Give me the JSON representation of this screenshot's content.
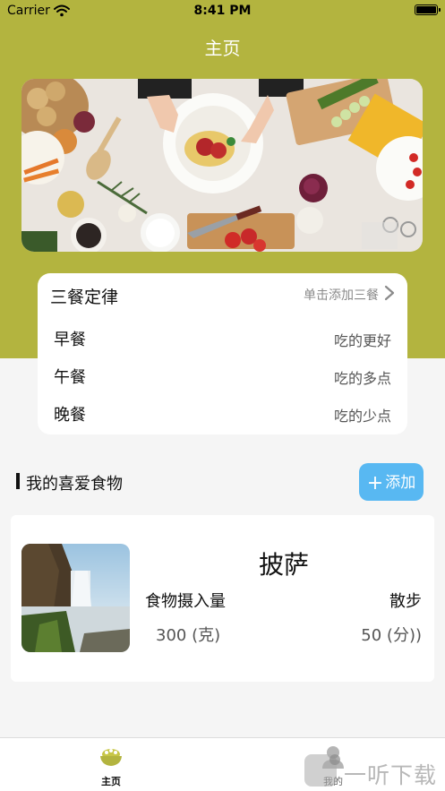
{
  "status_bar": {
    "carrier": "Carrier",
    "time": "8:41 PM"
  },
  "nav": {
    "title": "主页"
  },
  "meals": {
    "title": "三餐定律",
    "add_hint": "单击添加三餐",
    "items": [
      {
        "name": "早餐",
        "tip": "吃的更好"
      },
      {
        "name": "午餐",
        "tip": "吃的多点"
      },
      {
        "name": "晚餐",
        "tip": "吃的少点"
      }
    ]
  },
  "favorites": {
    "title": "我的喜爱食物",
    "add_label": "添加",
    "items": [
      {
        "name": "披萨",
        "intake_label": "食物摄入量",
        "intake_value": "300 (克)",
        "walk_label": "散步",
        "walk_value": "50 (分))"
      }
    ]
  },
  "tabs": [
    {
      "label": "主页",
      "icon": "bowl-icon",
      "active": true
    },
    {
      "label": "我的",
      "icon": "person-icon",
      "active": false
    }
  ],
  "watermark": {
    "text": "一听下载"
  },
  "colors": {
    "theme": "#b3b43f",
    "accent": "#58b8f2",
    "background": "#f5f5f5"
  }
}
